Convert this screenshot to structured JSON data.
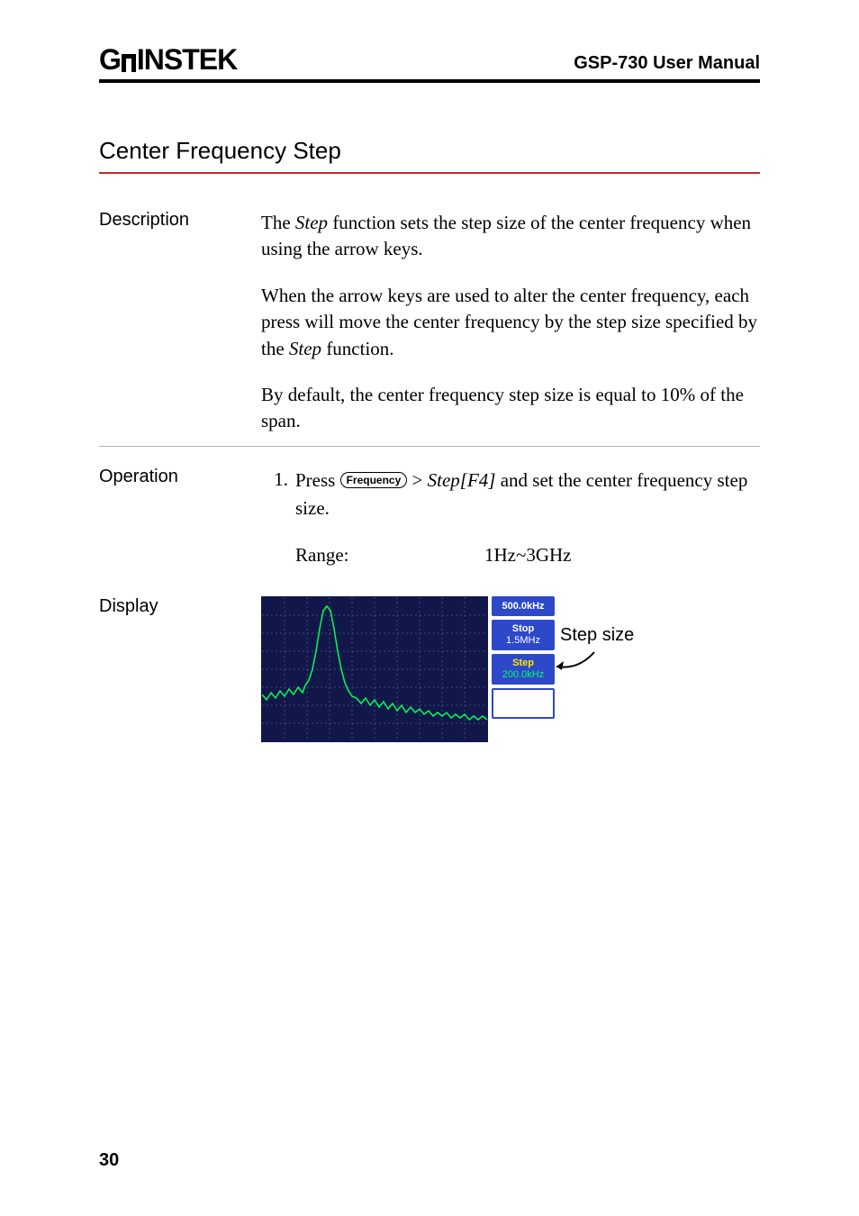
{
  "header": {
    "logo_left": "G",
    "logo_right": "INSTEK",
    "manual_title": "GSP-730 User Manual"
  },
  "section": {
    "heading": "Center Frequency Step"
  },
  "description": {
    "label": "Description",
    "para1_pre": "The ",
    "para1_em": "Step",
    "para1_post": " function sets the step size of the center frequency when using the arrow keys.",
    "para2_pre": "When the arrow keys are used to alter the center frequency, each press will move the center frequency by the step size specified by the ",
    "para2_em": "Step",
    "para2_post": " function.",
    "para3": "By default, the center frequency step size is equal to 10% of the span."
  },
  "operation": {
    "label": "Operation",
    "number": "1.",
    "press": "Press ",
    "button_label": "Frequency",
    "gt": " > ",
    "step_em": "Step[F4]",
    "rest": " and set the center frequency step size.",
    "range_label": "Range:",
    "range_value": "1Hz~3GHz"
  },
  "display": {
    "label": "Display",
    "softkeys": {
      "k1": "500.0kHz",
      "k2_line1": "Stop",
      "k2_line2": "1.5MHz",
      "k3_line1": "Step",
      "k3_line2": "200.0kHz"
    },
    "annotation": "Step size"
  },
  "page_number": "30"
}
